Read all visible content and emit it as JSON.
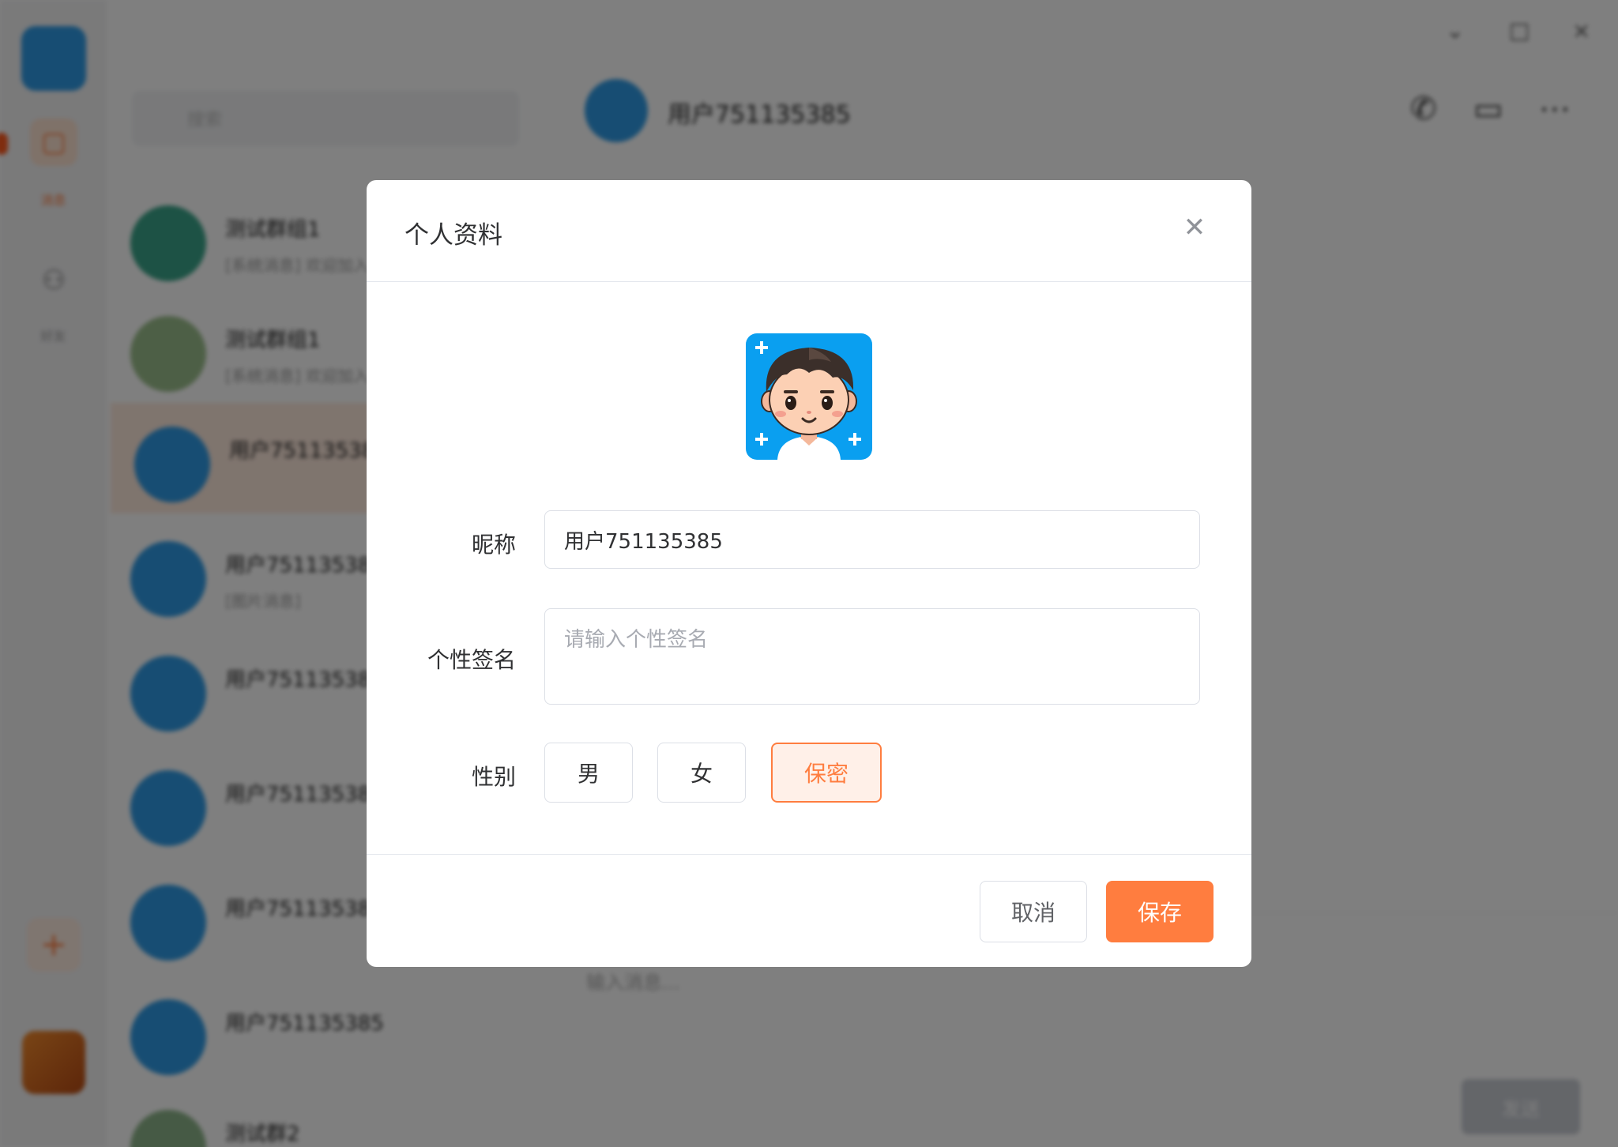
{
  "background": {
    "main": {
      "title": "用户751135385",
      "composer_placeholder": "输入消息...",
      "send_label": "发送"
    },
    "rail": {
      "chat_label": "消息",
      "contacts_label": "好友"
    },
    "search": {
      "placeholder": "搜索"
    },
    "chats": [
      {
        "name": "测试群组1",
        "message": "[系统消息] 欢迎加入",
        "time": ""
      },
      {
        "name": "测试群组1",
        "message": "[系统消息] 欢迎加入",
        "time": ""
      },
      {
        "name": "用户751135385",
        "message": "",
        "time": ""
      },
      {
        "name": "用户751135385",
        "message": "[图片消息]",
        "time": ""
      },
      {
        "name": "用户751135385",
        "message": "",
        "time": ""
      },
      {
        "name": "用户751135385",
        "message": "",
        "time": ""
      },
      {
        "name": "用户751135385",
        "message": "",
        "time": ""
      },
      {
        "name": "用户751135385",
        "message": "",
        "time": ""
      },
      {
        "name": "测试群2",
        "message": "",
        "time": ""
      }
    ]
  },
  "modal": {
    "title": "个人资料",
    "nickname": {
      "label": "昵称",
      "value": "用户751135385"
    },
    "signature": {
      "label": "个性签名",
      "value": "",
      "placeholder": "请输入个性签名"
    },
    "gender": {
      "label": "性别",
      "options": [
        "男",
        "女",
        "保密"
      ],
      "selected": "保密"
    },
    "buttons": {
      "cancel": "取消",
      "save": "保存"
    }
  },
  "colors": {
    "accent": "#ff7d3f",
    "overlay": "rgba(0,0,0,0.5)"
  }
}
